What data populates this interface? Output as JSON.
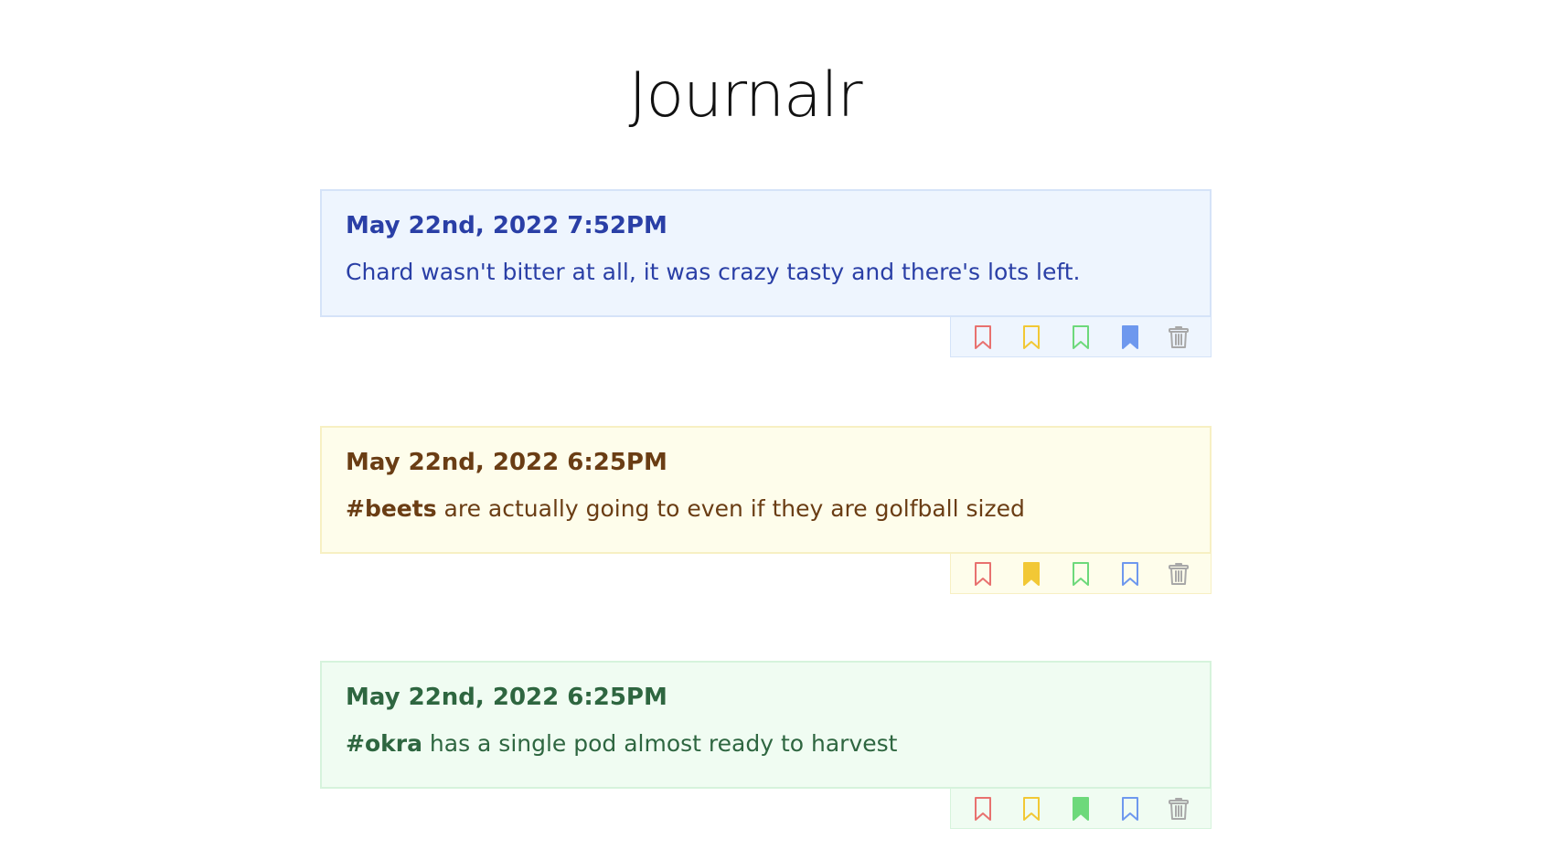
{
  "app": {
    "title": "Journalr"
  },
  "entries": [
    {
      "date": "May 22nd, 2022 7:52PM",
      "tag": "",
      "text": "Chard wasn't bitter at all, it was crazy tasty and there's lots left.",
      "theme": "blue",
      "active_bookmark": "blue"
    },
    {
      "date": "May 22nd, 2022 6:25PM",
      "tag": "#beets",
      "text": " are actually going to even if they are golfball sized",
      "theme": "yellow",
      "active_bookmark": "yellow"
    },
    {
      "date": "May 22nd, 2022 6:25PM",
      "tag": "#okra",
      "text": " has a single pod almost ready to harvest",
      "theme": "green",
      "active_bookmark": "green"
    }
  ],
  "actions": [
    {
      "name": "red-bookmark-icon",
      "color": "#e8716f"
    },
    {
      "name": "yellow-bookmark-icon",
      "color": "#f2c835"
    },
    {
      "name": "green-bookmark-icon",
      "color": "#6dd97b"
    },
    {
      "name": "blue-bookmark-icon",
      "color": "#6e98ee"
    },
    {
      "name": "trash-icon",
      "color": "#a8a8a8"
    }
  ],
  "themes": {
    "blue": {
      "bg": "#eef5fe",
      "border": "#d5e3f8",
      "text": "#2a3fa6"
    },
    "yellow": {
      "bg": "#fefdeb",
      "border": "#f7f0c3",
      "text": "#6a3d14"
    },
    "green": {
      "bg": "#f0fcf2",
      "border": "#d6f3dc",
      "text": "#2e6640"
    }
  }
}
